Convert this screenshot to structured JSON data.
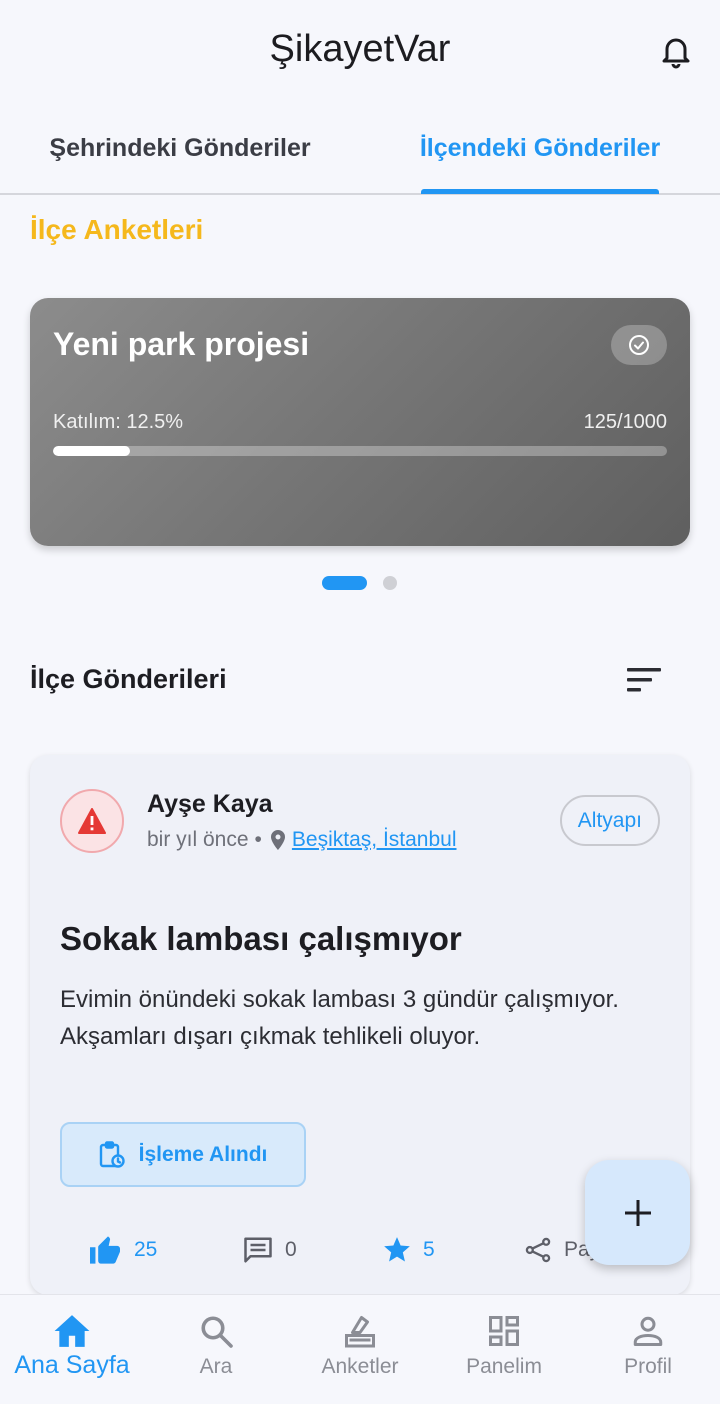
{
  "app": {
    "title": "ŞikayetVar"
  },
  "tabs": {
    "city": "Şehrindeki Gönderiler",
    "district": "İlçendeki Gönderiler"
  },
  "surveys": {
    "section_title": "İlçe Anketleri",
    "card": {
      "title": "Yeni park projesi",
      "participation_label": "Katılım: 12.5%",
      "count_label": "125/1000",
      "progress": 0.125
    },
    "page_count": 2,
    "active_page": 0
  },
  "posts": {
    "section_title": "İlçe Gönderileri",
    "items": [
      {
        "author": "Ayşe Kaya",
        "time": "bir yıl önce",
        "separator": "•",
        "location": "Beşiktaş, İstanbul",
        "category": "Altyapı",
        "title": "Sokak lambası çalışmıyor",
        "body": "Evimin önündeki sokak lambası 3 gündür çalışmıyor. Akşamları dışarı çıkmak tehlikeli oluyor.",
        "status": "İşleme Alındı",
        "likes": "25",
        "comments": "0",
        "stars": "5",
        "share_label": "Paylaş"
      }
    ]
  },
  "nav": {
    "home": "Ana Sayfa",
    "search": "Ara",
    "surveys": "Anketler",
    "panel": "Panelim",
    "profile": "Profil"
  },
  "colors": {
    "accent": "#2196f3",
    "survey_header": "#f5b81c",
    "danger": "#e53935"
  }
}
